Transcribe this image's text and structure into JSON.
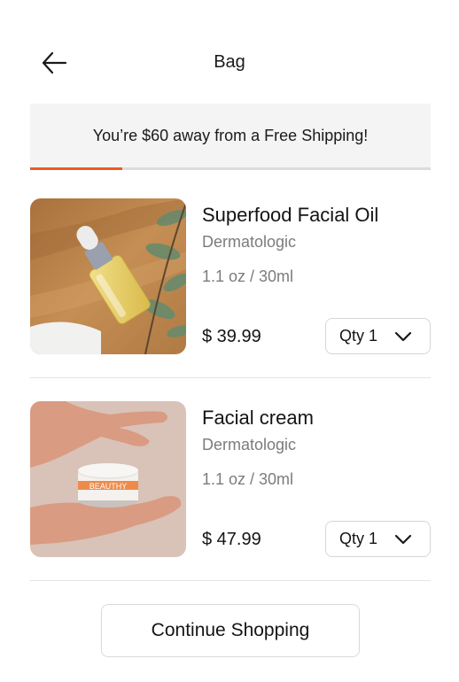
{
  "header": {
    "title": "Bag"
  },
  "shipping_banner": {
    "message": "You’re $60 away from a Free Shipping!",
    "progress": 0.23
  },
  "items": [
    {
      "name": "Superfood Facial Oil",
      "brand": "Dermatologic",
      "size": "1.1 oz / 30ml",
      "price": "$ 39.99",
      "qty_label": "Qty 1"
    },
    {
      "name": "Facial cream",
      "brand": "Dermatologic",
      "size": "1.1 oz / 30ml",
      "price": "$ 47.99",
      "qty_label": "Qty 1",
      "jar_label": "BEAUTHY"
    }
  ],
  "continue_label": "Continue Shopping",
  "colors": {
    "accent": "#ee5a24",
    "banner_bg": "#f4f4f4"
  }
}
